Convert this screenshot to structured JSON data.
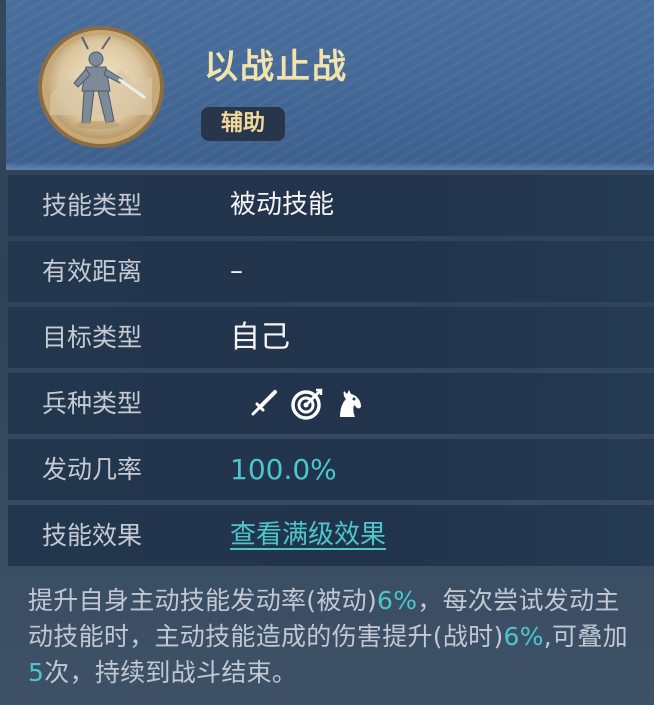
{
  "skill": {
    "name": "以战止战",
    "tag": "辅助"
  },
  "rows": [
    {
      "label": "技能类型",
      "value": "被动技能"
    },
    {
      "label": "有效距离",
      "value": "–"
    },
    {
      "label": "目标类型",
      "value": "自己"
    },
    {
      "label": "兵种类型",
      "icons": [
        "sword-icon",
        "bow-target-icon",
        "horse-icon"
      ]
    },
    {
      "label": "发动几率",
      "value": "100.0%"
    },
    {
      "label": "技能效果",
      "value": "查看满级效果"
    }
  ],
  "description": {
    "part1": "提升自身主动技能发动率(被动)",
    "val1": "6%",
    "part2": "，每次尝试发动主动技能时，主动技能造成的伤害提升(战时)",
    "val2": "6%",
    "part3": ",可叠加",
    "val3": "5",
    "part4": "次，持续到战斗结束。"
  },
  "colors": {
    "title": "#f4e2ac",
    "highlight": "#4cc6cc",
    "header_bg": "#456a98",
    "row_bg": "#22364e"
  }
}
